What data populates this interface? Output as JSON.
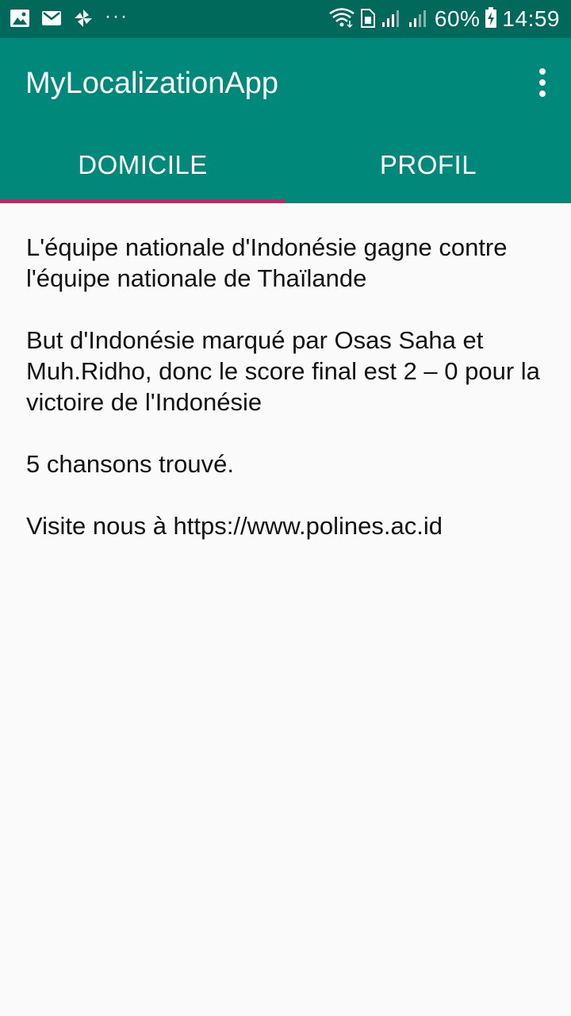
{
  "status_bar": {
    "battery": "60%",
    "time": "14:59",
    "overflow_dots": "···",
    "icons": [
      "image-icon",
      "mail-icon",
      "pinwheel-icon",
      "wifi-icon",
      "sim-icon",
      "signal-icon",
      "signal-icon",
      "battery-charging-icon"
    ]
  },
  "app_bar": {
    "title": "MyLocalizationApp",
    "background": "#00897b",
    "status_background": "#00695c"
  },
  "tabs": [
    {
      "label": "DOMICILE",
      "selected": true
    },
    {
      "label": "PROFIL",
      "selected": false
    }
  ],
  "tab_indicator_color": "#d81b60",
  "content": {
    "paragraph1": "L'équipe nationale d'Indonésie gagne contre l'équipe nationale de Thaïlande",
    "paragraph2": "But d'Indonésie marqué par Osas Saha et Muh.Ridho, donc le score final est 2 – 0 pour la victoire de l'Indonésie",
    "paragraph3": "5 chansons trouvé.",
    "paragraph4": "Visite nous à https://www.polines.ac.id"
  }
}
